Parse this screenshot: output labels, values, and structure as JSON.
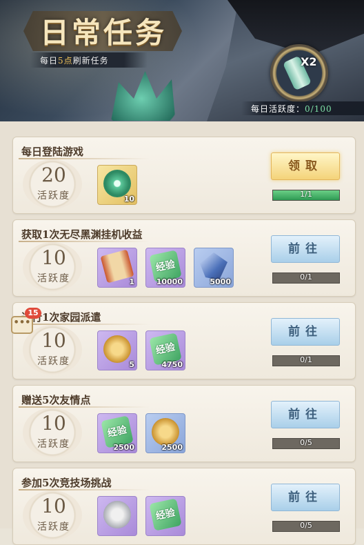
{
  "header": {
    "title": "日常任务",
    "refresh_prefix": "每日",
    "refresh_hour": "5点",
    "refresh_suffix": "刷新任务",
    "multiplier": "X2",
    "activity_label": "每日活跃度：",
    "activity_value": "0/100"
  },
  "chat": {
    "badge_count": "15",
    "bubble": "•••"
  },
  "tasks": [
    {
      "title": "每日登陆游戏",
      "points": "20",
      "points_label": "活跃度",
      "rewards": [
        {
          "icon": "jade-token-icon",
          "qty": "10",
          "rarity": "gold"
        }
      ],
      "button": "领取",
      "button_type": "claim",
      "progress_text": "1/1",
      "progress_fraction": 1.0
    },
    {
      "title": "获取1次无尽黑渊挂机收益",
      "points": "10",
      "points_label": "活跃度",
      "rewards": [
        {
          "icon": "scroll-icon",
          "qty": "1",
          "rarity": "purple"
        },
        {
          "icon": "exp-stone-icon",
          "qty": "10000",
          "rarity": "purple",
          "label": "经验"
        },
        {
          "icon": "crystal-icon",
          "qty": "5000",
          "rarity": "blue"
        }
      ],
      "button": "前往",
      "button_type": "go",
      "progress_text": "0/1",
      "progress_fraction": 0
    },
    {
      "title": "进行1次家园派遣",
      "points": "10",
      "points_label": "活跃度",
      "rewards": [
        {
          "icon": "gold-coin-icon",
          "qty": "5",
          "rarity": "purple"
        },
        {
          "icon": "exp-stone-icon",
          "qty": "4750",
          "rarity": "purple",
          "label": "经验"
        }
      ],
      "button": "前往",
      "button_type": "go",
      "progress_text": "0/1",
      "progress_fraction": 0
    },
    {
      "title": "赠送5次友情点",
      "points": "10",
      "points_label": "活跃度",
      "rewards": [
        {
          "icon": "exp-stone-icon",
          "qty": "2500",
          "rarity": "purple",
          "label": "经验"
        },
        {
          "icon": "copper-coin-icon",
          "qty": "2500",
          "rarity": "blue"
        }
      ],
      "button": "前往",
      "button_type": "go",
      "progress_text": "0/5",
      "progress_fraction": 0
    },
    {
      "title": "参加5次竞技场挑战",
      "points": "10",
      "points_label": "活跃度",
      "rewards": [
        {
          "icon": "silver-coin-icon",
          "qty": "",
          "rarity": "purple"
        },
        {
          "icon": "exp-stone-icon",
          "qty": "",
          "rarity": "purple",
          "label": "经验"
        }
      ],
      "button": "前往",
      "button_type": "go",
      "progress_text": "0/5",
      "progress_fraction": 0
    }
  ]
}
